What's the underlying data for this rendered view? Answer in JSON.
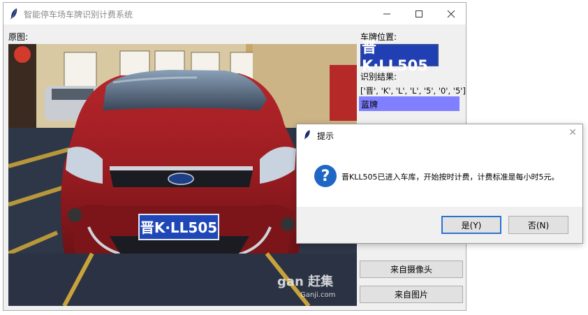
{
  "window": {
    "title": "智能停车场车牌识别计费系统",
    "controls": {
      "minimize": "minimize-icon",
      "maximize": "maximize-icon",
      "close": "close-icon"
    }
  },
  "labels": {
    "original_image": "原图:",
    "plate_location": "车牌位置:",
    "recognition_result": "识别结果:"
  },
  "plate_crop_text": "晋K·LL505",
  "photo": {
    "plate_text": "晋K·LL505",
    "watermark_brand": "gan 赶集",
    "watermark_url": "Ganji.com"
  },
  "result": {
    "chars": "['晋', 'K', 'L', 'L', '5', '0', '5']",
    "plate_color": "蓝牌",
    "plate_color_hex": "#7f7fff"
  },
  "buttons": {
    "from_camera": "来自摄像头",
    "from_image": "来自图片"
  },
  "dialog": {
    "title": "提示",
    "icon": "question-icon",
    "message": "晋KLL505已进入车库，开始按时计费，计费标准是每小时5元。",
    "yes": "是(Y)",
    "no": "否(N)"
  }
}
